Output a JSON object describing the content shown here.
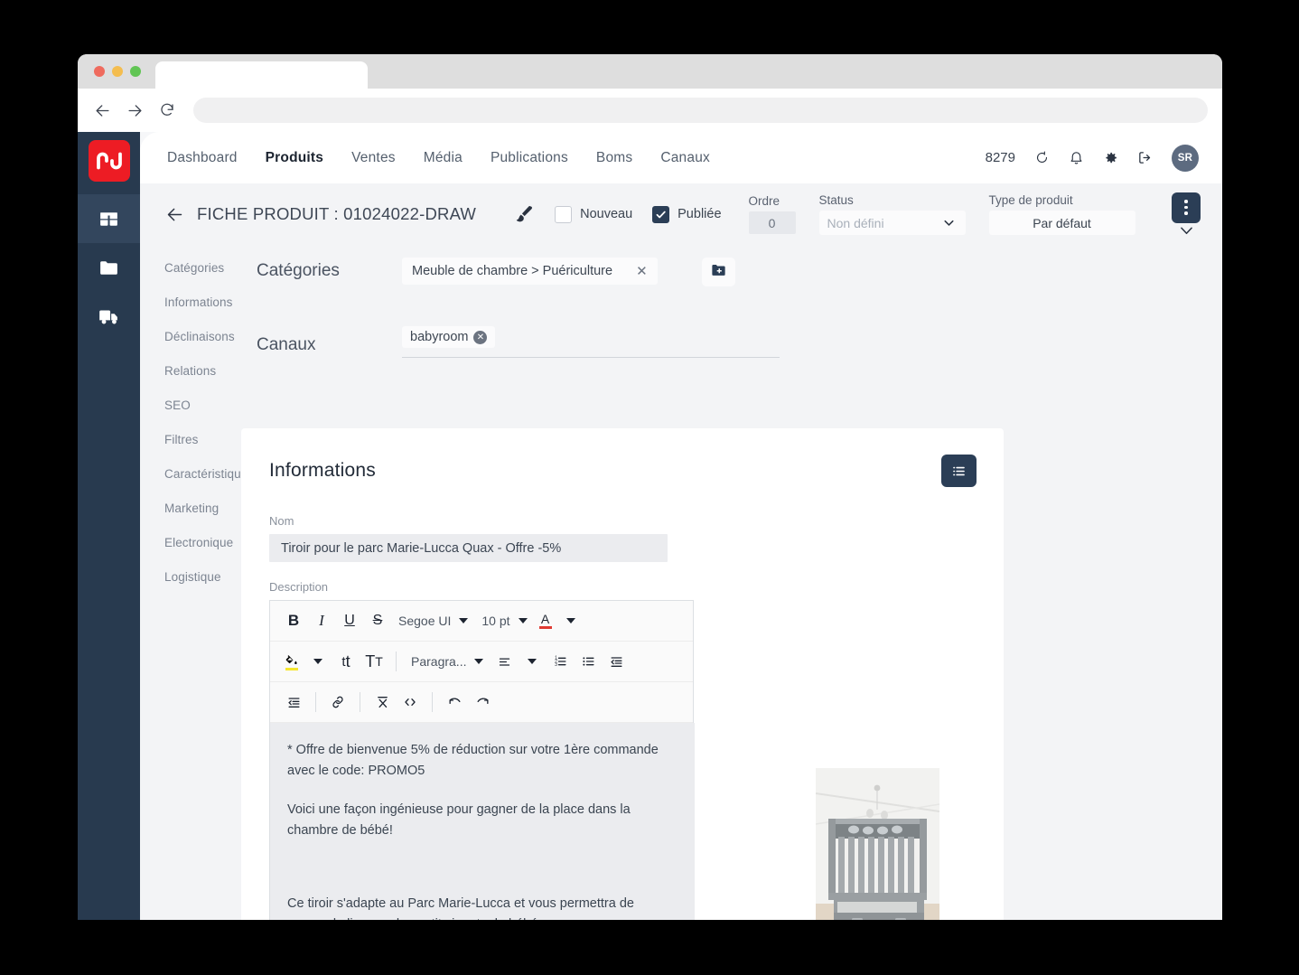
{
  "browser": {
    "back_icon": "arrow-left-icon",
    "forward_icon": "arrow-right-icon",
    "reload_icon": "reload-icon",
    "url_value": "",
    "url_placeholder": ""
  },
  "rail": {
    "logo_label": "n2",
    "items": [
      {
        "name": "products",
        "icon": "box-icon",
        "active": true
      },
      {
        "name": "files",
        "icon": "folder-icon",
        "active": false
      },
      {
        "name": "shipping",
        "icon": "truck-icon",
        "active": false
      }
    ]
  },
  "topnav": {
    "links": [
      {
        "label": "Dashboard",
        "active": false
      },
      {
        "label": "Produits",
        "active": true
      },
      {
        "label": "Ventes",
        "active": false
      },
      {
        "label": "Média",
        "active": false
      },
      {
        "label": "Publications",
        "active": false
      },
      {
        "label": "Boms",
        "active": false
      },
      {
        "label": "Canaux",
        "active": false
      }
    ],
    "count": "8279",
    "icons": [
      "refresh-icon",
      "bell-icon",
      "gear-icon",
      "logout-icon"
    ],
    "avatar_initials": "SR"
  },
  "header": {
    "title": "FICHE PRODUIT : 01024022-DRAW",
    "brush_icon": "paint-brush-icon",
    "nouveau_label": "Nouveau",
    "nouveau_checked": false,
    "publiee_label": "Publiée",
    "publiee_checked": true,
    "ordre_label": "Ordre",
    "ordre_value": "0",
    "status_label": "Status",
    "status_value": "Non défini",
    "type_label": "Type de produit",
    "type_value": "Par défaut",
    "kebab_icon": "more-vertical-icon"
  },
  "sidemenu": {
    "items": [
      {
        "label": "Catégories"
      },
      {
        "label": "Informations"
      },
      {
        "label": "Déclinaisons"
      },
      {
        "label": "Relations"
      },
      {
        "label": "SEO"
      },
      {
        "label": "Filtres"
      },
      {
        "label": "Caractéristiques"
      },
      {
        "label": "Marketing"
      },
      {
        "label": "Electronique"
      },
      {
        "label": "Logistique"
      }
    ]
  },
  "form": {
    "categories_label": "Catégories",
    "category_chip": "Meuble de chambre > Puériculture",
    "category_remove": "✕",
    "add_icon": "folder-plus-icon",
    "canaux_label": "Canaux",
    "canal_chip": "babyroom",
    "canal_remove": "✕"
  },
  "info_card": {
    "title": "Informations",
    "list_icon": "list-icon",
    "nom_label": "Nom",
    "nom_value": "Tiroir pour le parc Marie-Lucca Quax - Offre -5%",
    "description_label": "Description"
  },
  "editor": {
    "row1": [
      {
        "name": "bold-button",
        "glyph": "B",
        "kind": "bold"
      },
      {
        "name": "italic-button",
        "glyph": "I",
        "kind": "italic"
      },
      {
        "name": "underline-button",
        "glyph": "U",
        "kind": "under"
      },
      {
        "name": "strikethrough-button",
        "glyph": "S",
        "kind": "strike"
      }
    ],
    "font_family": "Segoe UI",
    "font_size": "10 pt",
    "text_color_letter": "A",
    "paragraph_style": "Paragra...",
    "row2_icons": [
      "fill-color-icon",
      "increase-font-size-icon",
      "decrease-font-size-icon",
      "align-icon",
      "numbered-list-icon",
      "bulleted-list-icon",
      "outdent-icon"
    ],
    "row3_icons": [
      "indent-icon",
      "link-icon",
      "clear-format-icon",
      "source-code-icon",
      "undo-icon",
      "redo-icon"
    ]
  },
  "description": {
    "paragraphs": [
      "* Offre de bienvenue 5% de réduction sur votre 1ère commande avec le code: PROMO5",
      "Voici une façon ingénieuse pour gagner de la place dans la chambre de bébé!",
      "Ce tiroir s'adapte au Parc Marie-Lucca et vous permettra de ranger du linge ou les petits jouets de bébé."
    ]
  },
  "product_image": {
    "alt": "grey-wooden-baby-crib-with-drawer"
  },
  "colors": {
    "rail": "#283a4f",
    "accent_dark": "#2b3e56",
    "logo_red": "#ed1c24",
    "page_bg": "#f3f4f6",
    "field_bg": "#ebecef"
  }
}
